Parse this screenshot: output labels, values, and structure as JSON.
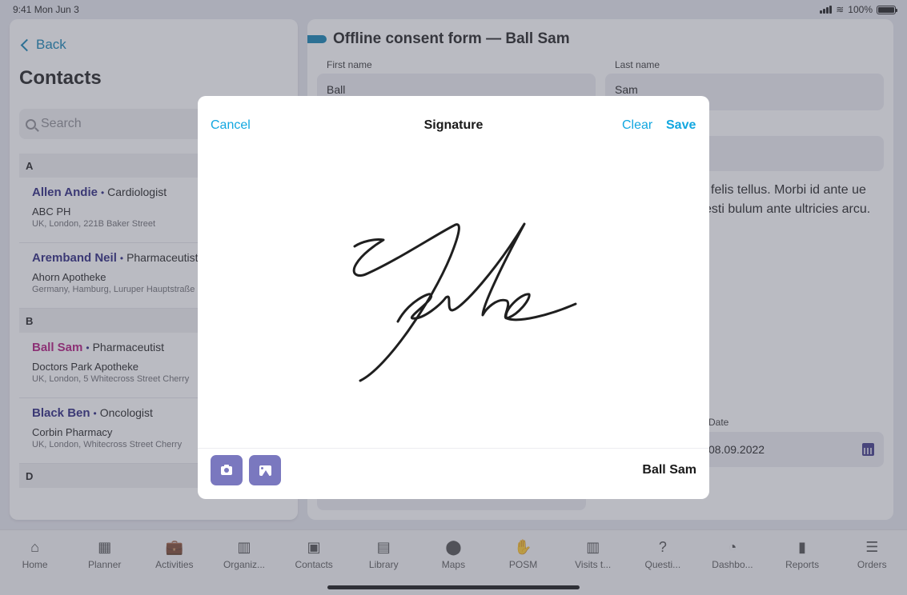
{
  "status_bar": {
    "time": "9:41",
    "date": "Mon Jun 3",
    "battery": "100%",
    "battery_level": 1.0
  },
  "left_panel": {
    "back_label": "Back",
    "title": "Contacts",
    "search_placeholder": "Search",
    "sections": [
      {
        "letter": "A",
        "contacts": [
          {
            "name": "Allen Andie",
            "role": "Cardiologist",
            "org": "ABC PH",
            "address": "UK, London, 221B Baker Street"
          },
          {
            "name": "Aremband Neil",
            "role": "Pharmaceutist",
            "org": "Ahorn Apotheke",
            "address": "Germany, Hamburg, Luruper Hauptstraße"
          }
        ]
      },
      {
        "letter": "B",
        "contacts": [
          {
            "name": "Ball Sam",
            "role": "Pharmaceutist",
            "org": "Doctors Park Apotheke",
            "address": "UK, London, 5 Whitecross Street Cherry",
            "selected": true
          },
          {
            "name": "Black Ben",
            "role": "Oncologist",
            "org": "Corbin Pharmacy",
            "address": "UK, London, Whitecross Street Cherry"
          }
        ]
      },
      {
        "letter": "D",
        "contacts": []
      }
    ]
  },
  "form": {
    "title": "Offline consent form — Ball Sam",
    "first_name_label": "First name",
    "first_name_value": "Ball",
    "last_name_label": "Last name",
    "last_name_value": "Sam",
    "body_text": "is felis tellus. Morbi id ante ue vesti bulum ante ultricies arcu.",
    "date_label": "Date",
    "date_value": "08.09.2022",
    "signature_name": "Ball Sam"
  },
  "modal": {
    "title": "Signature",
    "cancel_label": "Cancel",
    "clear_label": "Clear",
    "save_label": "Save",
    "signer_name": "Ball Sam",
    "camera_icon": "camera-icon",
    "image_icon": "image-icon"
  },
  "tabbar": {
    "items": [
      {
        "label": "Home",
        "icon": "⌂"
      },
      {
        "label": "Planner",
        "icon": "▦"
      },
      {
        "label": "Activities",
        "icon": "💼"
      },
      {
        "label": "Organiz...",
        "icon": "▥"
      },
      {
        "label": "Contacts",
        "icon": "▣"
      },
      {
        "label": "Library",
        "icon": "▤"
      },
      {
        "label": "Maps",
        "icon": "⬤"
      },
      {
        "label": "POSM",
        "icon": "✋"
      },
      {
        "label": "Visits t...",
        "icon": "▥"
      },
      {
        "label": "Questi...",
        "icon": "?"
      },
      {
        "label": "Dashbo...",
        "icon": "◔"
      },
      {
        "label": "Reports",
        "icon": "▮"
      },
      {
        "label": "Orders",
        "icon": "☰"
      }
    ]
  },
  "colors": {
    "accent": "#12a7e0",
    "brand_dark": "#25207a",
    "selected": "#b0127a",
    "button_purple": "#7a78bf"
  }
}
